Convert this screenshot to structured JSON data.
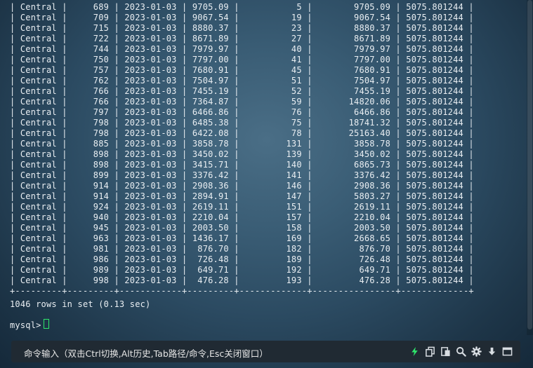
{
  "terminal": {
    "lines": [
      "| Central |     689 | 2023-01-03 | 9705.09 |           5 |        9705.09 | 5075.801244 |",
      "| Central |     709 | 2023-01-03 | 9067.54 |          19 |        9067.54 | 5075.801244 |",
      "| Central |     715 | 2023-01-03 | 8880.37 |          23 |        8880.37 | 5075.801244 |",
      "| Central |     722 | 2023-01-03 | 8671.89 |          27 |        8671.89 | 5075.801244 |",
      "| Central |     744 | 2023-01-03 | 7979.97 |          40 |        7979.97 | 5075.801244 |",
      "| Central |     750 | 2023-01-03 | 7797.00 |          41 |        7797.00 | 5075.801244 |",
      "| Central |     757 | 2023-01-03 | 7680.91 |          45 |        7680.91 | 5075.801244 |",
      "| Central |     762 | 2023-01-03 | 7504.97 |          51 |        7504.97 | 5075.801244 |",
      "| Central |     766 | 2023-01-03 | 7455.19 |          52 |        7455.19 | 5075.801244 |",
      "| Central |     766 | 2023-01-03 | 7364.87 |          59 |       14820.06 | 5075.801244 |",
      "| Central |     797 | 2023-01-03 | 6466.86 |          76 |        6466.86 | 5075.801244 |",
      "| Central |     798 | 2023-01-03 | 6485.38 |          75 |       18741.32 | 5075.801244 |",
      "| Central |     798 | 2023-01-03 | 6422.08 |          78 |       25163.40 | 5075.801244 |",
      "| Central |     885 | 2023-01-03 | 3858.78 |         131 |        3858.78 | 5075.801244 |",
      "| Central |     898 | 2023-01-03 | 3450.02 |         139 |        3450.02 | 5075.801244 |",
      "| Central |     898 | 2023-01-03 | 3415.71 |         140 |        6865.73 | 5075.801244 |",
      "| Central |     899 | 2023-01-03 | 3376.42 |         141 |        3376.42 | 5075.801244 |",
      "| Central |     914 | 2023-01-03 | 2908.36 |         146 |        2908.36 | 5075.801244 |",
      "| Central |     914 | 2023-01-03 | 2894.91 |         147 |        5803.27 | 5075.801244 |",
      "| Central |     924 | 2023-01-03 | 2619.11 |         151 |        2619.11 | 5075.801244 |",
      "| Central |     940 | 2023-01-03 | 2210.04 |         157 |        2210.04 | 5075.801244 |",
      "| Central |     945 | 2023-01-03 | 2003.50 |         158 |        2003.50 | 5075.801244 |",
      "| Central |     963 | 2023-01-03 | 1436.17 |         169 |        2668.65 | 5075.801244 |",
      "| Central |     981 | 2023-01-03 |  876.70 |         182 |         876.70 | 5075.801244 |",
      "| Central |     986 | 2023-01-03 |  726.48 |         189 |         726.48 | 5075.801244 |",
      "| Central |     989 | 2023-01-03 |  649.71 |         192 |         649.71 | 5075.801244 |",
      "| Central |     998 | 2023-01-03 |  476.28 |         193 |         476.28 | 5075.801244 |",
      "+---------+---------+------------+---------+-------------+----------------+-------------+",
      "1046 rows in set (0.13 sec)",
      "",
      "mysql> "
    ]
  },
  "command_bar": {
    "hint": "命令输入（双击Ctrl切换,Alt历史,Tab路径/命令,Esc关闭窗口）",
    "icons": [
      "lightning-icon",
      "copy-icon",
      "paste-icon",
      "search-icon",
      "gear-icon",
      "download-icon",
      "window-icon"
    ],
    "accent": "#2ee66b"
  }
}
